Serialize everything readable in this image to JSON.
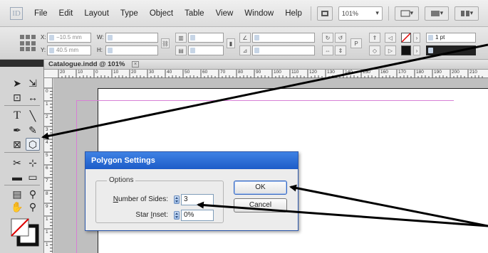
{
  "app": {
    "logo": "ID"
  },
  "menubar": {
    "items": [
      "File",
      "Edit",
      "Layout",
      "Type",
      "Object",
      "Table",
      "View",
      "Window",
      "Help"
    ],
    "zoom": "101%"
  },
  "control_panel": {
    "x_label": "X:",
    "y_label": "Y:",
    "w_label": "W:",
    "h_label": "H:",
    "x_value": "−10.5 mm",
    "y_value": "40.5 mm",
    "stroke_weight": "1 pt"
  },
  "tools": {
    "icons": [
      "selection-icon",
      "direct-selection-icon",
      "page-tool-icon",
      "gap-tool-icon",
      "type-tool-icon",
      "line-tool-icon",
      "pen-tool-icon",
      "pencil-tool-icon",
      "rectangle-frame-tool-icon",
      "polygon-tool-icon",
      "scissors-tool-icon",
      "free-transform-tool-icon",
      "gradient-swatch-tool-icon",
      "gradient-feather-tool-icon",
      "note-tool-icon",
      "eyedropper-tool-icon",
      "hand-tool-icon",
      "zoom-tool-icon"
    ]
  },
  "document": {
    "tab_title": "Catalogue.indd @ 101%",
    "ruler_h": [
      "20",
      "10",
      "0",
      "10",
      "20",
      "30",
      "40",
      "50",
      "60",
      "70",
      "80",
      "90",
      "100",
      "110",
      "120",
      "130",
      "140",
      "150",
      "160",
      "170",
      "180",
      "190",
      "200",
      "210"
    ],
    "ruler_v": [
      "0",
      "1",
      "2",
      "3",
      "4",
      "5",
      "6",
      "7",
      "8",
      "9",
      "1",
      "1",
      "1",
      "1"
    ]
  },
  "dialog": {
    "title": "Polygon Settings",
    "group_label": "Options",
    "sides_label": "Number of Sides:",
    "sides_value": "3",
    "inset_label": "Star Inset:",
    "inset_value": "0%",
    "ok_label": "OK",
    "cancel_label": "Cancel"
  },
  "colors": {
    "dialog_title": "#1d5cc8",
    "margin_guide": "#d77fd6",
    "arrow": "#000000"
  }
}
